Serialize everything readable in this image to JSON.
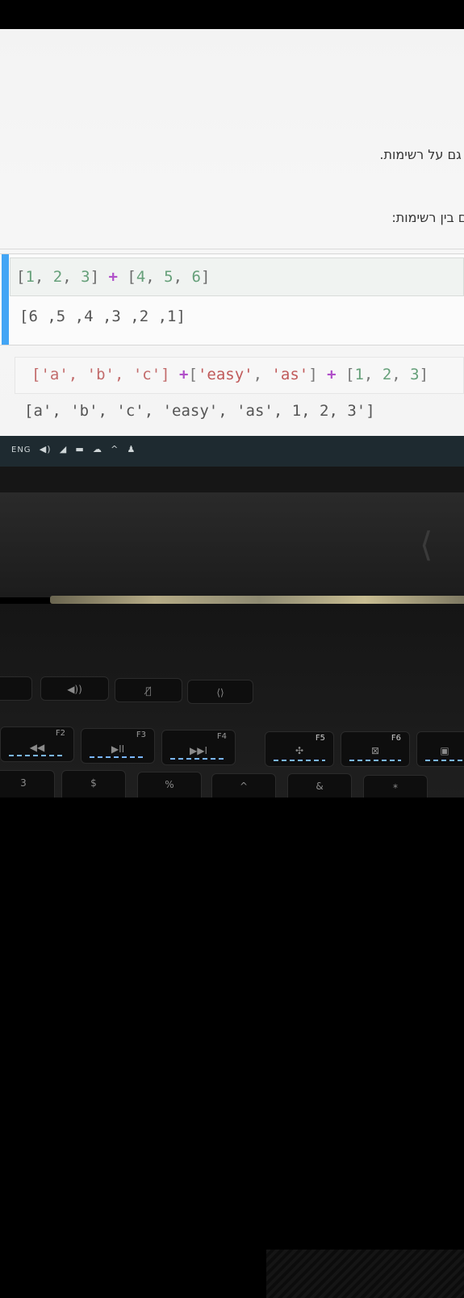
{
  "notebook": {
    "heading1": "הדר גם על רשימות.",
    "heading2": "גם בין רשימות:",
    "cell1": {
      "code_parts": [
        "[",
        "1",
        ", ",
        "2",
        ", ",
        "3",
        "]",
        " + ",
        "[",
        "4",
        ", ",
        "5",
        ", ",
        "6",
        "]"
      ],
      "output": "[6 ,5 ,4 ,3 ,2 ,1]"
    },
    "cell2": {
      "code_parts": [
        "['a', 'b', 'c']",
        " +",
        "[",
        "'easy'",
        ", ",
        "'as'",
        "]",
        " + ",
        "[",
        "1",
        ", ",
        "2",
        ", ",
        "3",
        "]"
      ],
      "output": "[a', 'b', 'c', 'easy', 'as', 1, 2, 3']"
    }
  },
  "taskbar": {
    "language": "ENG",
    "icons": [
      "volume-icon",
      "network-icon",
      "battery-icon",
      "cloud-icon",
      "chevron-up-icon",
      "person-icon"
    ]
  },
  "keyboard": {
    "top_row": [
      "volume-up-icon",
      "mic-mute-icon",
      "rog-icon"
    ],
    "fn_keys": [
      {
        "fn": "F2",
        "label": "◀◀"
      },
      {
        "fn": "F3",
        "label": "▶II"
      },
      {
        "fn": "F4",
        "label": "▶▶I"
      },
      {
        "fn": "F5",
        "label": "fan"
      },
      {
        "fn": "F6",
        "label": "⊠"
      }
    ],
    "number_row": [
      "3",
      "$",
      "%",
      "^",
      "&",
      "*"
    ]
  }
}
